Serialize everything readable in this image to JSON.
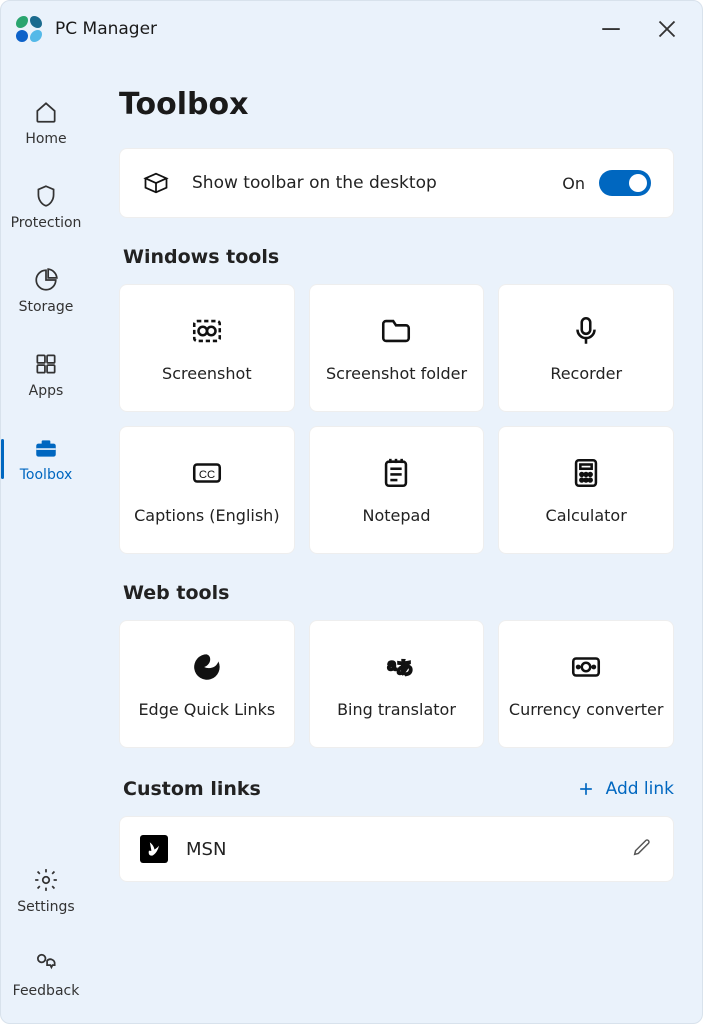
{
  "app": {
    "title": "PC Manager"
  },
  "sidebar": {
    "items": [
      {
        "label": "Home"
      },
      {
        "label": "Protection"
      },
      {
        "label": "Storage"
      },
      {
        "label": "Apps"
      },
      {
        "label": "Toolbox"
      }
    ],
    "footer": [
      {
        "label": "Settings"
      },
      {
        "label": "Feedback"
      }
    ]
  },
  "page": {
    "title": "Toolbox",
    "toolbar": {
      "label": "Show toolbar on the desktop",
      "state": "On"
    },
    "sections": {
      "windows_tools": {
        "title": "Windows tools",
        "items": [
          {
            "label": "Screenshot"
          },
          {
            "label": "Screenshot folder"
          },
          {
            "label": "Recorder"
          },
          {
            "label": "Captions (English)"
          },
          {
            "label": "Notepad"
          },
          {
            "label": "Calculator"
          }
        ]
      },
      "web_tools": {
        "title": "Web tools",
        "items": [
          {
            "label": "Edge Quick Links"
          },
          {
            "label": "Bing translator"
          },
          {
            "label": "Currency converter"
          }
        ]
      },
      "custom_links": {
        "title": "Custom links",
        "add_label": "Add link",
        "items": [
          {
            "label": "MSN"
          }
        ]
      }
    }
  }
}
